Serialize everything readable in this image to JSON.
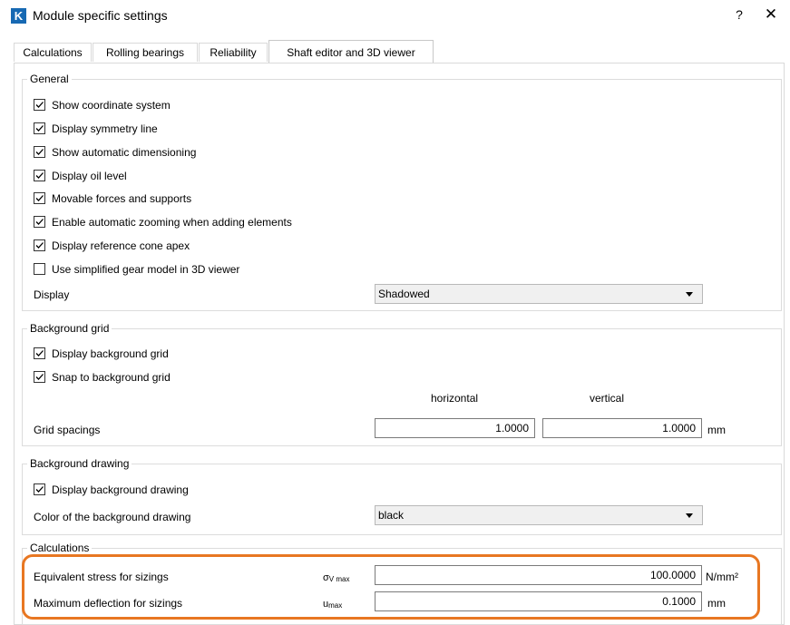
{
  "window": {
    "app_icon_letter": "K",
    "title": "Module specific settings",
    "help": "?",
    "close": "✕"
  },
  "tabs": [
    "Calculations",
    "Rolling bearings",
    "Reliability",
    "Shaft editor and 3D viewer"
  ],
  "general": {
    "title": "General",
    "checkboxes": [
      {
        "label": "Show coordinate system",
        "checked": true
      },
      {
        "label": "Display symmetry line",
        "checked": true
      },
      {
        "label": "Show automatic dimensioning",
        "checked": true
      },
      {
        "label": "Display oil level",
        "checked": true
      },
      {
        "label": "Movable forces and supports",
        "checked": true
      },
      {
        "label": "Enable automatic zooming when adding elements",
        "checked": true
      },
      {
        "label": "Display reference cone apex",
        "checked": true
      },
      {
        "label": "Use simplified gear model in 3D viewer",
        "checked": false
      }
    ],
    "display_label": "Display",
    "display_value": "Shadowed"
  },
  "background_grid": {
    "title": "Background grid",
    "checkboxes": [
      {
        "label": "Display background grid",
        "checked": true
      },
      {
        "label": "Snap to background grid",
        "checked": true
      }
    ],
    "col_horizontal": "horizontal",
    "col_vertical": "vertical",
    "spacing_label": "Grid spacings",
    "horizontal_value": "1.0000",
    "vertical_value": "1.0000",
    "unit": "mm"
  },
  "background_drawing": {
    "title": "Background drawing",
    "checkboxes": [
      {
        "label": "Display background drawing",
        "checked": true
      }
    ],
    "color_label": "Color of the background drawing",
    "color_value": "black"
  },
  "calculations": {
    "title": "Calculations",
    "stress_label": "Equivalent stress for sizings",
    "stress_symbol": "σ",
    "stress_symbol_sub": "V max",
    "stress_value": "100.0000",
    "stress_unit": "N/mm²",
    "deflection_label": "Maximum deflection for sizings",
    "deflection_symbol": "u",
    "deflection_symbol_sub": "max",
    "deflection_value": "0.1000",
    "deflection_unit": "mm"
  },
  "colors": {
    "highlight": "#e87722",
    "app_icon": "#1769b3"
  }
}
